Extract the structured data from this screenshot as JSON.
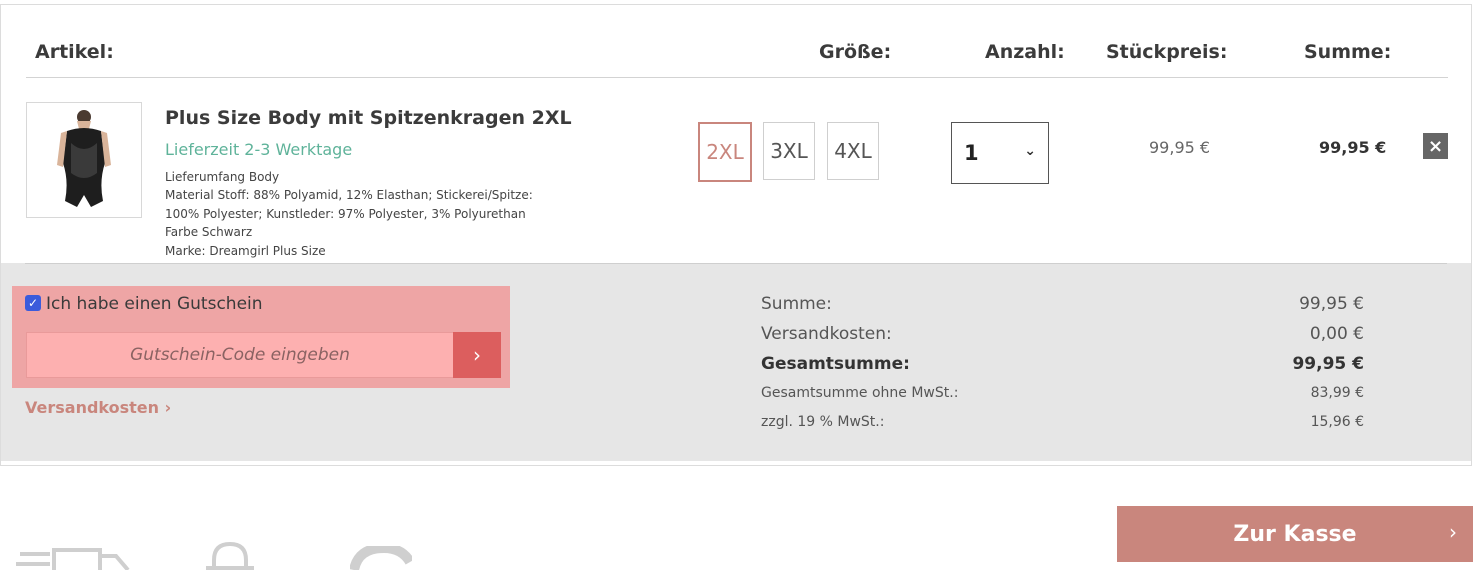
{
  "table_header": {
    "article": "Artikel:",
    "size": "Größe:",
    "quantity": "Anzahl:",
    "unit_price": "Stückpreis:",
    "total": "Summe:"
  },
  "item": {
    "title": "Plus Size Body mit Spitzenkragen 2XL",
    "delivery": "Lieferzeit 2-3 Werktage",
    "details": [
      "Lieferumfang Body",
      "Material Stoff: 88% Polyamid, 12% Elasthan; Stickerei/Spitze:",
      "100% Polyester; Kunstleder: 97% Polyester, 3% Polyurethan",
      "Farbe Schwarz",
      "Marke: Dreamgirl Plus Size"
    ],
    "sizes": [
      "2XL",
      "3XL",
      "4XL"
    ],
    "selected_size": "2XL",
    "quantity": "1",
    "unit_price": "99,95 €",
    "row_total": "99,95 €",
    "remove_icon": "×"
  },
  "coupon": {
    "checkbox_label": "Ich habe einen Gutschein",
    "placeholder": "Gutschein-Code eingeben",
    "submit_icon": "›"
  },
  "shipping_link": "Versandkosten ›",
  "summary": {
    "subtotal_label": "Summe:",
    "subtotal_value": "99,95 €",
    "shipping_label": "Versandkosten:",
    "shipping_value": "0,00 €",
    "grand_total_label": "Gesamtsumme:",
    "grand_total_value": "99,95 €",
    "net_label": "Gesamtsumme ohne MwSt.:",
    "net_value": "83,99 €",
    "vat_label": "zzgl. 19 % MwSt.:",
    "vat_value": "15,96 €"
  },
  "checkout": {
    "label": "Zur Kasse",
    "arrow": "›"
  },
  "colors": {
    "accent": "#c9867d",
    "delivery_green": "#5fb39a",
    "coupon_highlight": "#eea5a5",
    "summary_bg": "#e6e6e6"
  },
  "icons": [
    "truck-icon",
    "lock-icon",
    "refresh-icon"
  ]
}
